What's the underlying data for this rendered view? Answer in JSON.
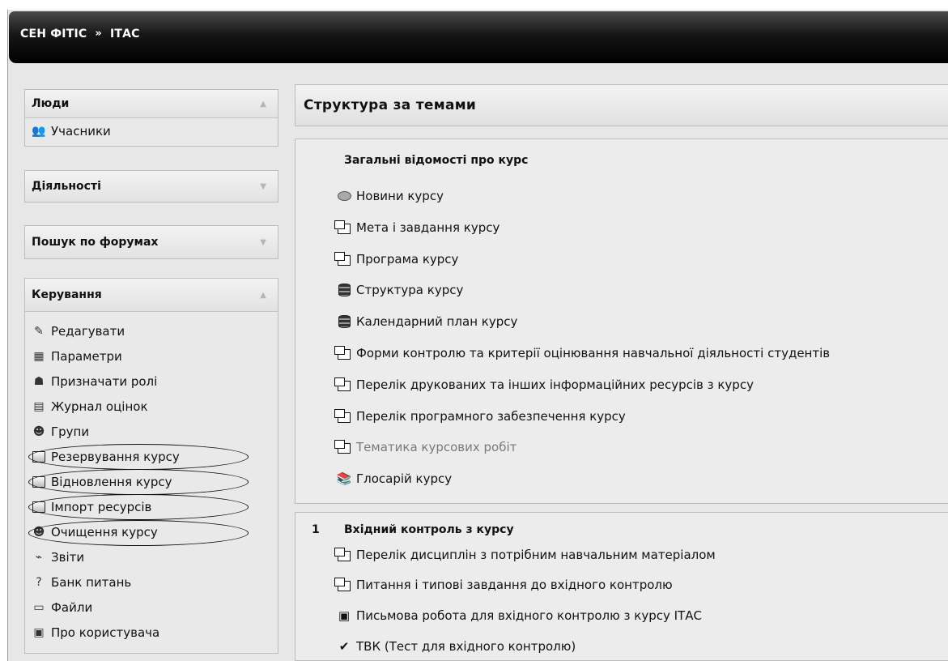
{
  "breadcrumb": {
    "root": "СЕН ФІТІС",
    "sep": "»",
    "current": "ІТАС"
  },
  "sidebar": {
    "people": {
      "title": "Люди",
      "items": [
        {
          "label": "Учасники",
          "icon": "participants-icon"
        }
      ]
    },
    "activities": {
      "title": "Діяльності"
    },
    "forum_search": {
      "title": "Пошук по форумах"
    },
    "admin": {
      "title": "Керування",
      "items": [
        {
          "label": "Редагувати",
          "icon": "edit-icon"
        },
        {
          "label": "Параметри",
          "icon": "settings-icon"
        },
        {
          "label": "Призначати ролі",
          "icon": "roles-icon"
        },
        {
          "label": "Журнал оцінок",
          "icon": "grades-icon"
        },
        {
          "label": "Групи",
          "icon": "groups-icon"
        },
        {
          "label": "Резервування курсу",
          "icon": "backup-icon"
        },
        {
          "label": "Відновлення курсу",
          "icon": "restore-icon"
        },
        {
          "label": "Імпорт ресурсів",
          "icon": "import-icon"
        },
        {
          "label": "Очищення курсу",
          "icon": "reset-icon"
        },
        {
          "label": "Звіти",
          "icon": "reports-icon"
        },
        {
          "label": "Банк питань",
          "icon": "question-bank-icon"
        },
        {
          "label": "Файли",
          "icon": "folder-icon"
        },
        {
          "label": "Про користувача",
          "icon": "profile-icon"
        }
      ]
    }
  },
  "main": {
    "title": "Структура за темами",
    "sections": [
      {
        "number": "",
        "title": "Загальні відомості про курс",
        "activities": [
          {
            "label": "Новини курсу",
            "icon": "forum-icon"
          },
          {
            "label": "Мета і завдання курсу",
            "icon": "page-icon"
          },
          {
            "label": "Програма курсу",
            "icon": "page-icon"
          },
          {
            "label": "Структура курсу",
            "icon": "database-icon"
          },
          {
            "label": "Календарний план курсу",
            "icon": "database-icon"
          },
          {
            "label": "Форми контролю та критерії оцінювання навчальної діяльності студентів",
            "icon": "page-icon"
          },
          {
            "label": "Перелік друкованих та інших інформаційних ресурсів з курсу",
            "icon": "page-icon"
          },
          {
            "label": "Перелік програмного забезпечення курсу",
            "icon": "page-icon"
          },
          {
            "label": "Тематика курсових робіт",
            "icon": "page-icon",
            "dimmed": true
          },
          {
            "label": "Глосарій курсу",
            "icon": "glossary-icon"
          }
        ]
      },
      {
        "number": "1",
        "title": "Вхідний контроль з курсу",
        "activities": [
          {
            "label": "Перелік дисциплін з потрібним навчальним матеріалом",
            "icon": "page-icon"
          },
          {
            "label": "Питання і типові завдання до вхідного контролю",
            "icon": "page-icon"
          },
          {
            "label": "Письмова робота для вхідного контролю з курсу ІТАС",
            "icon": "word-doc-icon"
          },
          {
            "label": "ТВК (Тест для вхідного контролю)",
            "icon": "quiz-icon"
          }
        ]
      }
    ]
  }
}
